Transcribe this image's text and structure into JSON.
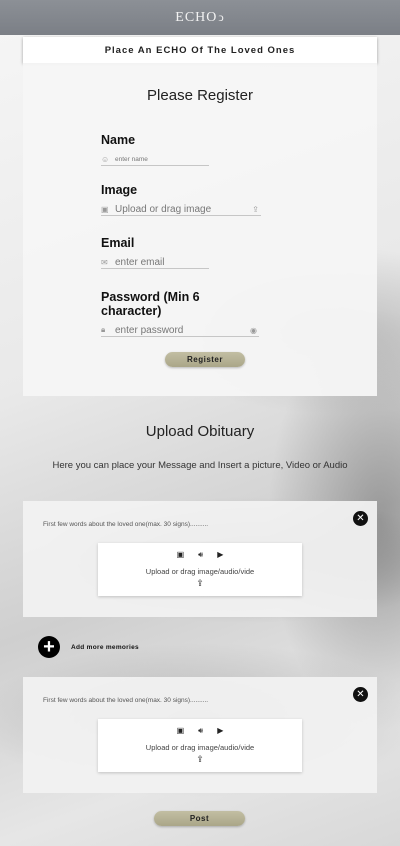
{
  "header": {
    "logo_text": "ECHO",
    "logo_mark": "ↄ"
  },
  "banner": {
    "title": "Place An ECHO Of The Loved Ones"
  },
  "register": {
    "title": "Please Register",
    "fields": [
      {
        "label": "Name",
        "placeholder": "enter name",
        "icon": "user-icon"
      },
      {
        "label": "Image",
        "placeholder": "Upload or drag image",
        "icon": "image-icon"
      },
      {
        "label": "Email",
        "placeholder": "enter email",
        "icon": "mail-icon"
      },
      {
        "label": "Password (Min 6 character)",
        "placeholder": "enter password",
        "icon": "lock-icon"
      }
    ],
    "submit_label": "Register"
  },
  "obituary": {
    "title": "Upload Obituary",
    "subtitle": "Here you can place your Message and Insert a picture, Video or Audio"
  },
  "memories": [
    {
      "hint": "First few words about the loved one(max. 30 signs)..........",
      "upload_text": "Upload or drag image/audio/vide"
    },
    {
      "hint": "First few words about the loved one(max. 30 signs)..........",
      "upload_text": "Upload or drag image/audio/vide"
    }
  ],
  "add_more_label": "Add more memories",
  "post_label": "Post",
  "colors": {
    "topbar": "#7f838a",
    "button": "#b8b497",
    "panel": "#f5f5f5"
  }
}
